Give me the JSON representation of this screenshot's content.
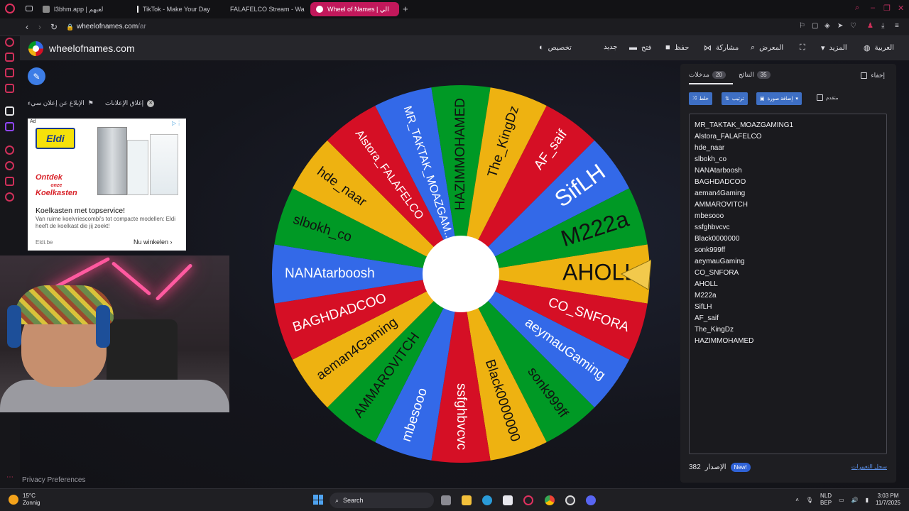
{
  "browser": {
    "tabs": [
      {
        "label": "l3bhm.app | لعبهم",
        "active": false,
        "color": "#888888"
      },
      {
        "label": "TikTok - Make Your Day",
        "active": false,
        "color": "#ffffff"
      },
      {
        "label": "FALAFELCO Stream - Wa",
        "active": false,
        "color": "#53fc18"
      },
      {
        "label": "Wheel of Names | الي",
        "active": true,
        "color": "#ffffff"
      }
    ],
    "new_tab": "+",
    "url_host": "wheelofnames.com",
    "url_path": "/ar"
  },
  "site": {
    "name": "wheelofnames.com",
    "menu": {
      "customize": "تخصيص",
      "new": "جديد",
      "open": "فتح",
      "save": "حفظ",
      "share": "مشاركة",
      "gallery": "المعرض",
      "more": "المزيد",
      "language": "العربية"
    }
  },
  "ads": {
    "report": "الإبلاغ عن إعلان سيء",
    "close": "إغلاق الإعلانات",
    "tag": "Ad",
    "brand": "Eldi",
    "promo_line1": "Ontdek",
    "promo_small": "onze",
    "promo_line2": "Koelkasten",
    "headline": "Koelkasten met topservice!",
    "body": "Van ruime koelvriescombi's tot compacte modellen: Eldi heeft de koelkast die jij zoekt!",
    "domain": "Eldi.be",
    "cta": "Nu winkelen"
  },
  "wheel": {
    "colors": [
      "#3369e8",
      "#d50f25",
      "#eeb211",
      "#009925"
    ],
    "slices": [
      "AHOLL",
      "CO_SNFORA",
      "aeymauGaming",
      "sonk999ff",
      "Black0000000",
      "ssfghbvcvc",
      "mbesooo",
      "AMMAROVITCH",
      "aeman4Gaming",
      "BAGHDADCOO",
      "NANAtarboosh",
      "slbokh_co",
      "hde_naar",
      "Alstora_FALAFELCO",
      "MR_TAKTAK_MOAZGAM...",
      "HAZIMMOHAMED",
      "The_KingDz",
      "AF_saif",
      "SifLH",
      "M222a"
    ],
    "slice_colors": [
      "#eeb211",
      "#d50f25",
      "#3369e8",
      "#009925",
      "#eeb211",
      "#d50f25",
      "#3369e8",
      "#009925",
      "#eeb211",
      "#d50f25",
      "#3369e8",
      "#009925",
      "#eeb211",
      "#d50f25",
      "#3369e8",
      "#009925",
      "#eeb211",
      "#d50f25",
      "#3369e8",
      "#009925"
    ]
  },
  "panel": {
    "hide": "إخفاء",
    "tab_entries": "مدخلات",
    "tab_entries_count": "20",
    "tab_results": "النتائج",
    "tab_results_count": "35",
    "shuffle": "خلط",
    "sort": "ترتيب",
    "add_image": "إضافة صورة",
    "advanced": "متقدم",
    "entries": [
      "MR_TAKTAK_MOAZGAMING1",
      "Alstora_FALAFELCO",
      "hde_naar",
      "slbokh_co",
      "NANAtarboosh",
      "BAGHDADCOO",
      "aeman4Gaming",
      "AMMAROVITCH",
      "mbesooo",
      "ssfghbvcvc",
      "Black0000000",
      "sonk999ff",
      "aeymauGaming",
      "CO_SNFORA",
      "AHOLL",
      "M222a",
      "SifLH",
      "AF_saif",
      "The_KingDz",
      "HAZIMMOHAMED"
    ],
    "version_label": "الإصدار",
    "version": "382",
    "new_badge": "New!",
    "changelog": "سجل التغييرات"
  },
  "footer": {
    "privacy": "Privacy Preferences"
  },
  "taskbar": {
    "temp": "15°C",
    "weather": "Zonnig",
    "search": "Search",
    "lang1": "NLD",
    "lang2": "BEP",
    "time": "3:03 PM",
    "date": "11/7/2025"
  }
}
